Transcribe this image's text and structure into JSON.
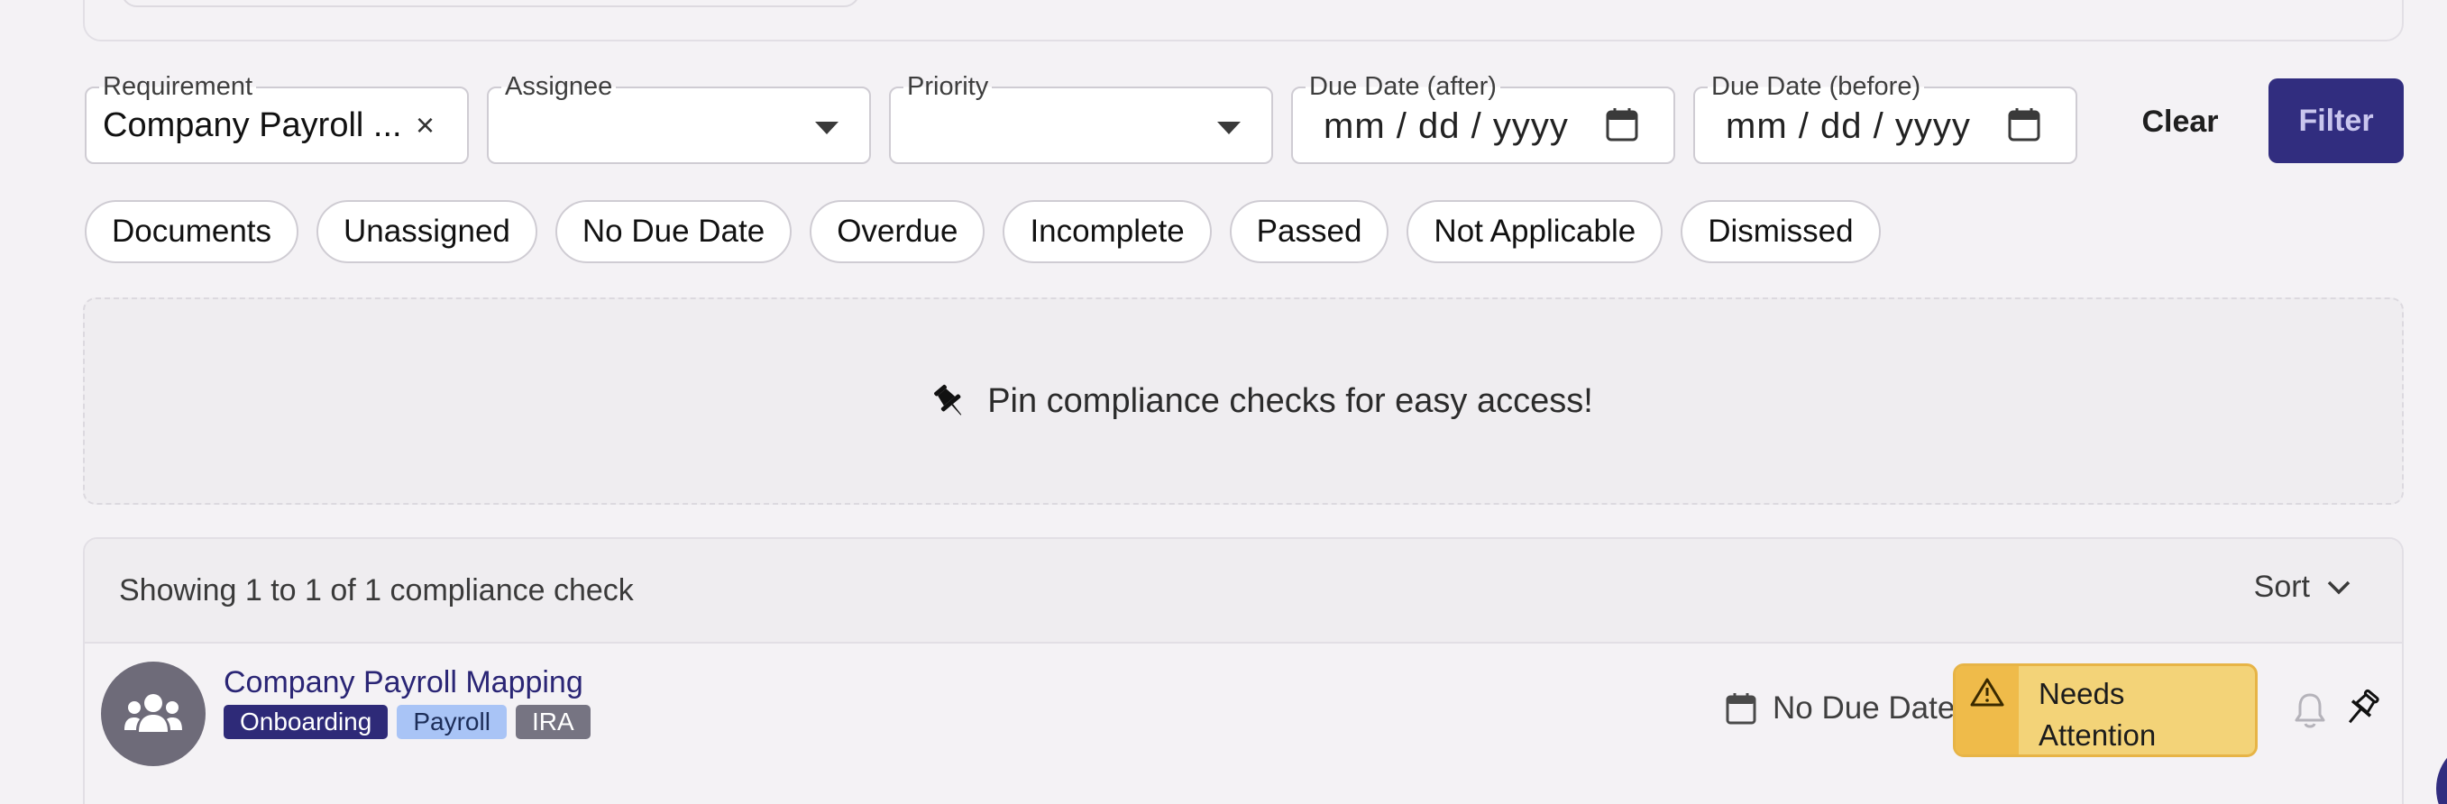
{
  "filters": {
    "requirement": {
      "label": "Requirement",
      "value": "Company Payroll ...",
      "clear": "×"
    },
    "assignee": {
      "label": "Assignee",
      "value": ""
    },
    "priority": {
      "label": "Priority",
      "value": ""
    },
    "due_after": {
      "label": "Due Date (after)",
      "placeholder": "mm / dd / yyyy"
    },
    "due_before": {
      "label": "Due Date (before)",
      "placeholder": "mm / dd / yyyy"
    },
    "clear_label": "Clear",
    "filter_label": "Filter"
  },
  "chips": [
    {
      "label": "Documents"
    },
    {
      "label": "Unassigned"
    },
    {
      "label": "No Due Date"
    },
    {
      "label": "Overdue"
    },
    {
      "label": "Incomplete"
    },
    {
      "label": "Passed"
    },
    {
      "label": "Not Applicable"
    },
    {
      "label": "Dismissed"
    }
  ],
  "pin_banner": {
    "text": "Pin compliance checks for easy access!",
    "icon": "pushpin-icon"
  },
  "list": {
    "count_text": "Showing 1 to 1 of 1 compliance check",
    "sort_label": "Sort",
    "rows": [
      {
        "title": "Company Payroll Mapping",
        "tags": [
          "Onboarding",
          "Payroll",
          "IRA"
        ],
        "due": "No Due Date",
        "status": "Needs Attention"
      }
    ]
  },
  "colors": {
    "primary": "#312d7f",
    "status_warning_bg": "#f3d378",
    "status_warning_border": "#e7b446",
    "tag_onboarding": "#2e2a78",
    "tag_payroll": "#a9c4f6",
    "tag_ira": "#767482"
  }
}
